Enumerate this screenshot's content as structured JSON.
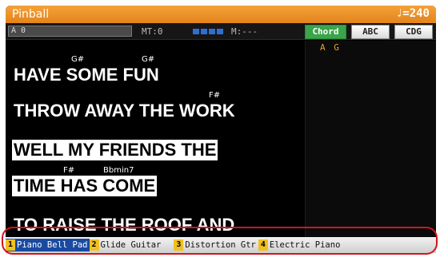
{
  "title_bar": {
    "song": "Pinball",
    "tempo": "♩=240"
  },
  "info_bar": {
    "marker": "A 0",
    "mt": "MT:0",
    "m": "M:---",
    "tabs": [
      {
        "label": "Chord",
        "active": true
      },
      {
        "label": "ABC",
        "active": false
      },
      {
        "label": "CDG",
        "active": false
      }
    ]
  },
  "chord_pane": {
    "chords": "A G"
  },
  "lyrics": {
    "line1": {
      "chords": [
        "G#",
        "G#"
      ],
      "text": "HAVE SOME FUN"
    },
    "line2": {
      "chords": [
        "F#"
      ],
      "text": "THROW AWAY THE WORK"
    },
    "line3": {
      "text": "WELL MY FRIENDS THE"
    },
    "line4": {
      "chords": [
        "F#",
        "Bbmin7"
      ],
      "text": "TIME HAS COME"
    },
    "line5": {
      "text": "TO RAISE THE ROOF AND"
    }
  },
  "instruments": [
    {
      "num": "1",
      "name": "Piano Bell Pad",
      "active": true
    },
    {
      "num": "2",
      "name": "Glide Guitar",
      "active": false
    },
    {
      "num": "3",
      "name": "Distortion Gtr",
      "active": false
    },
    {
      "num": "4",
      "name": "Electric Piano",
      "active": false
    }
  ],
  "colors": {
    "title_bar": "#e4841b",
    "chord_tab": "#3aa54a",
    "instr_num": "#f0c020",
    "active_instr": "#1a4aa0",
    "highlight_outline": "#d2151b"
  }
}
